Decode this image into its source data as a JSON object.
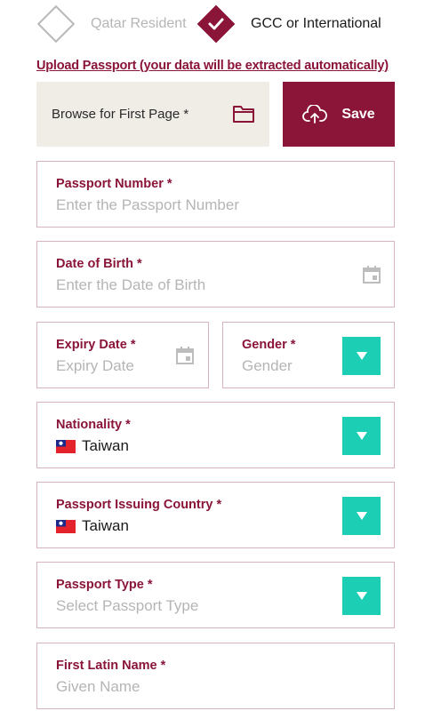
{
  "resident_toggle": {
    "qatar_resident_label": "Qatar Resident",
    "gcc_label": "GCC or International",
    "selected": "gcc"
  },
  "upload": {
    "link_text": "Upload Passport (your data will be extracted automatically)",
    "browse_label": "Browse for First Page *",
    "save_label": "Save"
  },
  "fields": {
    "passport_number": {
      "label": "Passport Number *",
      "placeholder": "Enter the Passport Number"
    },
    "date_of_birth": {
      "label": "Date of Birth *",
      "placeholder": "Enter the Date of Birth"
    },
    "expiry_date": {
      "label": "Expiry Date *",
      "placeholder": "Expiry Date"
    },
    "gender": {
      "label": "Gender *",
      "placeholder": "Gender"
    },
    "nationality": {
      "label": "Nationality *",
      "value": "Taiwan"
    },
    "issuing_country": {
      "label": "Passport Issuing Country *",
      "value": "Taiwan"
    },
    "passport_type": {
      "label": "Passport Type *",
      "placeholder": "Select Passport Type"
    },
    "first_latin_name": {
      "label": "First Latin Name *",
      "placeholder": "Given Name"
    }
  },
  "icons": {
    "folder": "folder-icon",
    "upload": "cloud-upload-icon",
    "calendar": "calendar-icon",
    "dropdown": "chevron-down-icon",
    "flag": "taiwan-flag-icon",
    "check": "check-icon"
  },
  "colors": {
    "brand": "#8a1538",
    "dropdown_accent": "#1ccfb4",
    "browse_bg": "#efede6",
    "field_border": "#d8b4bf",
    "placeholder": "#b5b5b5"
  }
}
